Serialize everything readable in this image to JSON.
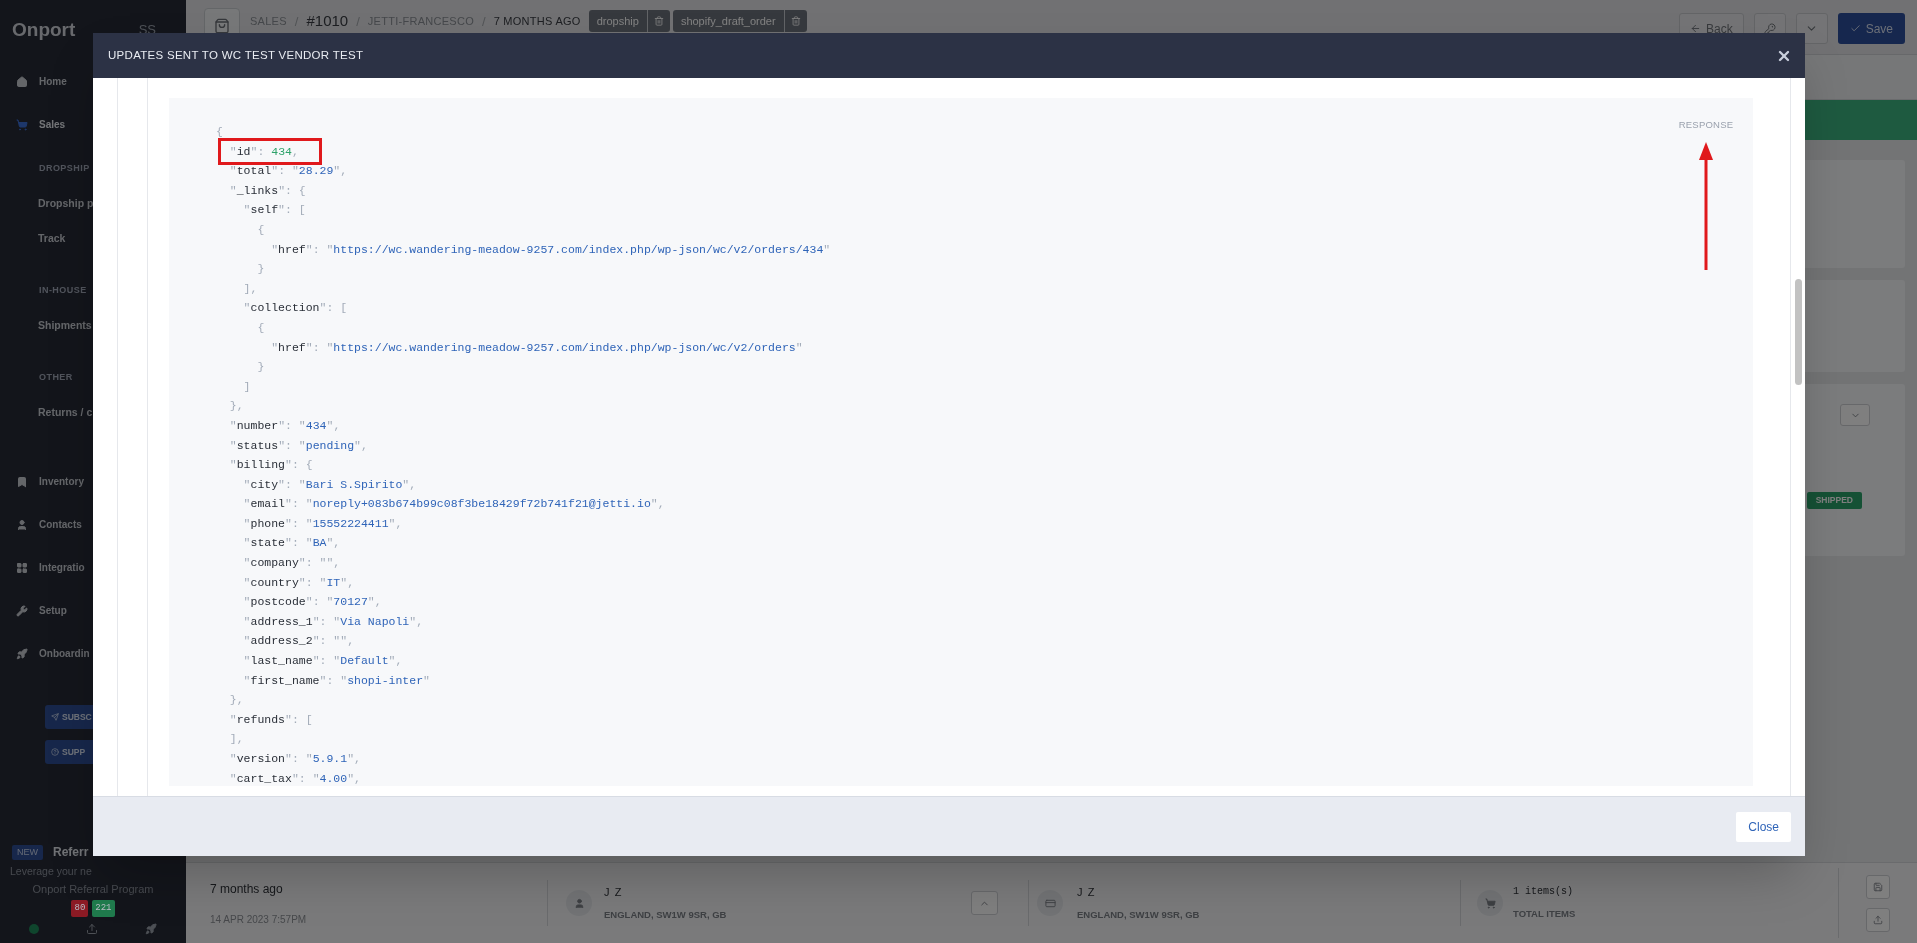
{
  "sidebar": {
    "logo": "Onport",
    "avatar": "SS",
    "items": [
      {
        "kind": "nav",
        "label": "Home",
        "selected": false
      },
      {
        "kind": "nav",
        "label": "Sales",
        "selected": true
      },
      {
        "kind": "section",
        "label": "DROPSHIP"
      },
      {
        "kind": "sub",
        "label": "Dropship p",
        "selected": false
      },
      {
        "kind": "sub",
        "label": "Track",
        "selected": false
      },
      {
        "kind": "section",
        "label": "IN-HOUSE"
      },
      {
        "kind": "sub",
        "label": "Shipments",
        "selected": false
      },
      {
        "kind": "section",
        "label": "OTHER"
      },
      {
        "kind": "sub",
        "label": "Returns / c",
        "selected": false
      },
      {
        "kind": "nav",
        "label": "Inventory",
        "selected": false
      },
      {
        "kind": "nav",
        "label": "Contacts",
        "selected": false
      },
      {
        "kind": "nav",
        "label": "Integratio",
        "selected": false
      },
      {
        "kind": "nav",
        "label": "Setup",
        "selected": false
      },
      {
        "kind": "nav",
        "label": "Onboardin",
        "selected": false
      }
    ],
    "buttons": [
      "SUBSC",
      "SUPP"
    ],
    "referral": {
      "badge": "NEW",
      "title": "Referr",
      "text": "Leverage your ne",
      "link": "Onport Referral Program"
    },
    "counters": [
      {
        "value": "80",
        "color": "#8b1a24"
      },
      {
        "value": "221",
        "color": "#1f7a4c"
      }
    ]
  },
  "header": {
    "breadcrumbs": [
      "SALES",
      "#1010",
      "JETTI-FRANCESCO",
      "7 MONTHS AGO"
    ],
    "separator": "/",
    "tags": [
      "dropship",
      "shopify_draft_order"
    ],
    "back": "Back",
    "save": "Save"
  },
  "side_panel": {
    "status": "SHIPPED"
  },
  "modal": {
    "title": "UPDATES SENT TO WC TEST VENDOR TEST",
    "section_label": "RESPONSE",
    "close": "Close",
    "lines": [
      {
        "text": "{",
        "highlighted": false
      },
      {
        "text": "  \"id\": 434,",
        "highlighted": true
      },
      {
        "text": "  \"total\": \"28.29\",",
        "highlighted": false
      },
      {
        "text": "  \"_links\": {",
        "highlighted": false
      },
      {
        "text": "    \"self\": [",
        "highlighted": false
      },
      {
        "text": "      {",
        "highlighted": false
      },
      {
        "text": "        \"href\": \"https://wc.wandering-meadow-9257.com/index.php/wp-json/wc/v2/orders/434\"",
        "highlighted": false
      },
      {
        "text": "      }",
        "highlighted": false
      },
      {
        "text": "    ],",
        "highlighted": false
      },
      {
        "text": "    \"collection\": [",
        "highlighted": false
      },
      {
        "text": "      {",
        "highlighted": false
      },
      {
        "text": "        \"href\": \"https://wc.wandering-meadow-9257.com/index.php/wp-json/wc/v2/orders\"",
        "highlighted": false
      },
      {
        "text": "      }",
        "highlighted": false
      },
      {
        "text": "    ]",
        "highlighted": false
      },
      {
        "text": "  },",
        "highlighted": false
      },
      {
        "text": "  \"number\": \"434\",",
        "highlighted": false
      },
      {
        "text": "  \"status\": \"pending\",",
        "highlighted": false
      },
      {
        "text": "  \"billing\": {",
        "highlighted": false
      },
      {
        "text": "    \"city\": \"Bari S.Spirito\",",
        "highlighted": false
      },
      {
        "text": "    \"email\": \"noreply+083b674b99c08f3be18429f72b741f21@jetti.io\",",
        "highlighted": false
      },
      {
        "text": "    \"phone\": \"15552224411\",",
        "highlighted": false
      },
      {
        "text": "    \"state\": \"BA\",",
        "highlighted": false
      },
      {
        "text": "    \"company\": \"\",",
        "highlighted": false
      },
      {
        "text": "    \"country\": \"IT\",",
        "highlighted": false
      },
      {
        "text": "    \"postcode\": \"70127\",",
        "highlighted": false
      },
      {
        "text": "    \"address_1\": \"Via Napoli\",",
        "highlighted": false
      },
      {
        "text": "    \"address_2\": \"\",",
        "highlighted": false
      },
      {
        "text": "    \"last_name\": \"Default\",",
        "highlighted": false
      },
      {
        "text": "    \"first_name\": \"shopi-inter\"",
        "highlighted": false
      },
      {
        "text": "  },",
        "highlighted": false
      },
      {
        "text": "  \"refunds\": [",
        "highlighted": false
      },
      {
        "text": "  ],",
        "highlighted": false
      },
      {
        "text": "  \"version\": \"5.9.1\",",
        "highlighted": false
      },
      {
        "text": "  \"cart_tax\": \"4.00\",",
        "highlighted": false
      }
    ]
  },
  "summary_bar": {
    "created": {
      "relative": "7 months ago",
      "date": "14 APR 2023 7:57PM"
    },
    "customer": {
      "name": "J Z",
      "address": "ENGLAND, SW1W 9SR, GB"
    },
    "billing": {
      "name": "J Z",
      "address": "ENGLAND, SW1W 9SR, GB"
    },
    "items": {
      "count": "1 items(s)",
      "label": "TOTAL ITEMS"
    }
  }
}
